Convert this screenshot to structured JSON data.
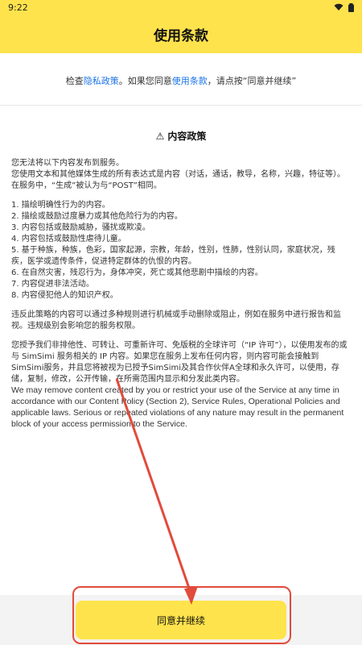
{
  "status": {
    "time": "9:22"
  },
  "app": {
    "title": "使用条款"
  },
  "intro": {
    "prefix": "检查",
    "privacy_link": "隐私政策",
    "middle": "。如果您同意",
    "terms_link": "使用条款",
    "suffix": "，请点按“同意并继续”"
  },
  "policy": {
    "icon": "warning-icon",
    "heading": "内容政策",
    "p1": "您无法将以下内容发布到服务。",
    "p2": "您使用文本和其他媒体生成的所有表达式是内容（对话，通话，教导，名称，兴趣，特征等）。在服务中，“生成”被认为与“POST”相同。",
    "items": [
      "1. 描绘明确性行为的内容。",
      "2. 描绘或鼓励过度暴力或其他危险行为的内容。",
      "3. 内容包括或鼓励威胁，骚扰或欺凌。",
      "4. 内容包括或鼓励性虐待儿童。",
      "5. 基于种族，种族，色彩，国家起源，宗教，年龄，性别，性肺，性别认同，家庭状况，残疾，医学或遗传条件，促进特定群体的仇恨的内容。",
      "6. 在自然灾害，残忍行为，身体冲突，死亡或其他悲剧中描绘的内容。",
      "7. 内容促进非法活动。",
      "8. 内容侵犯他人的知识产权。"
    ],
    "p3": "违反此策略的内容可以通过多种规则进行机械或手动删除或阻止，例如在服务中进行报告和监视。违规级别会影响您的服务权限。",
    "p4": "您授予我们非排他性、可转让、可重新许可、免版税的全球许可（“IP 许可”），以使用发布的或与 SimSimi 服务相关的 IP 内容。如果您在服务上发布任何内容，则内容可能会接触到SimSimi服务，并且您将被视为已授予SimSimi及其合作伙伴A全球和永久许可，以使用，存储，复制，修改，公开传输，在所需范围内显示和分发此类内容。",
    "p5_en": "We may remove content created by you or restrict your use of the Service at any time in accordance with our Content Policy (Section 2), Service Rules, Operational Policies and applicable laws. Serious or repeated violations of any nature may result in the permanent block of your access permission to the Service."
  },
  "footer": {
    "agree_label": "同意并继续"
  },
  "colors": {
    "accent": "#ffe34c",
    "link": "#1a73e8",
    "annotation": "#e14b3b"
  }
}
